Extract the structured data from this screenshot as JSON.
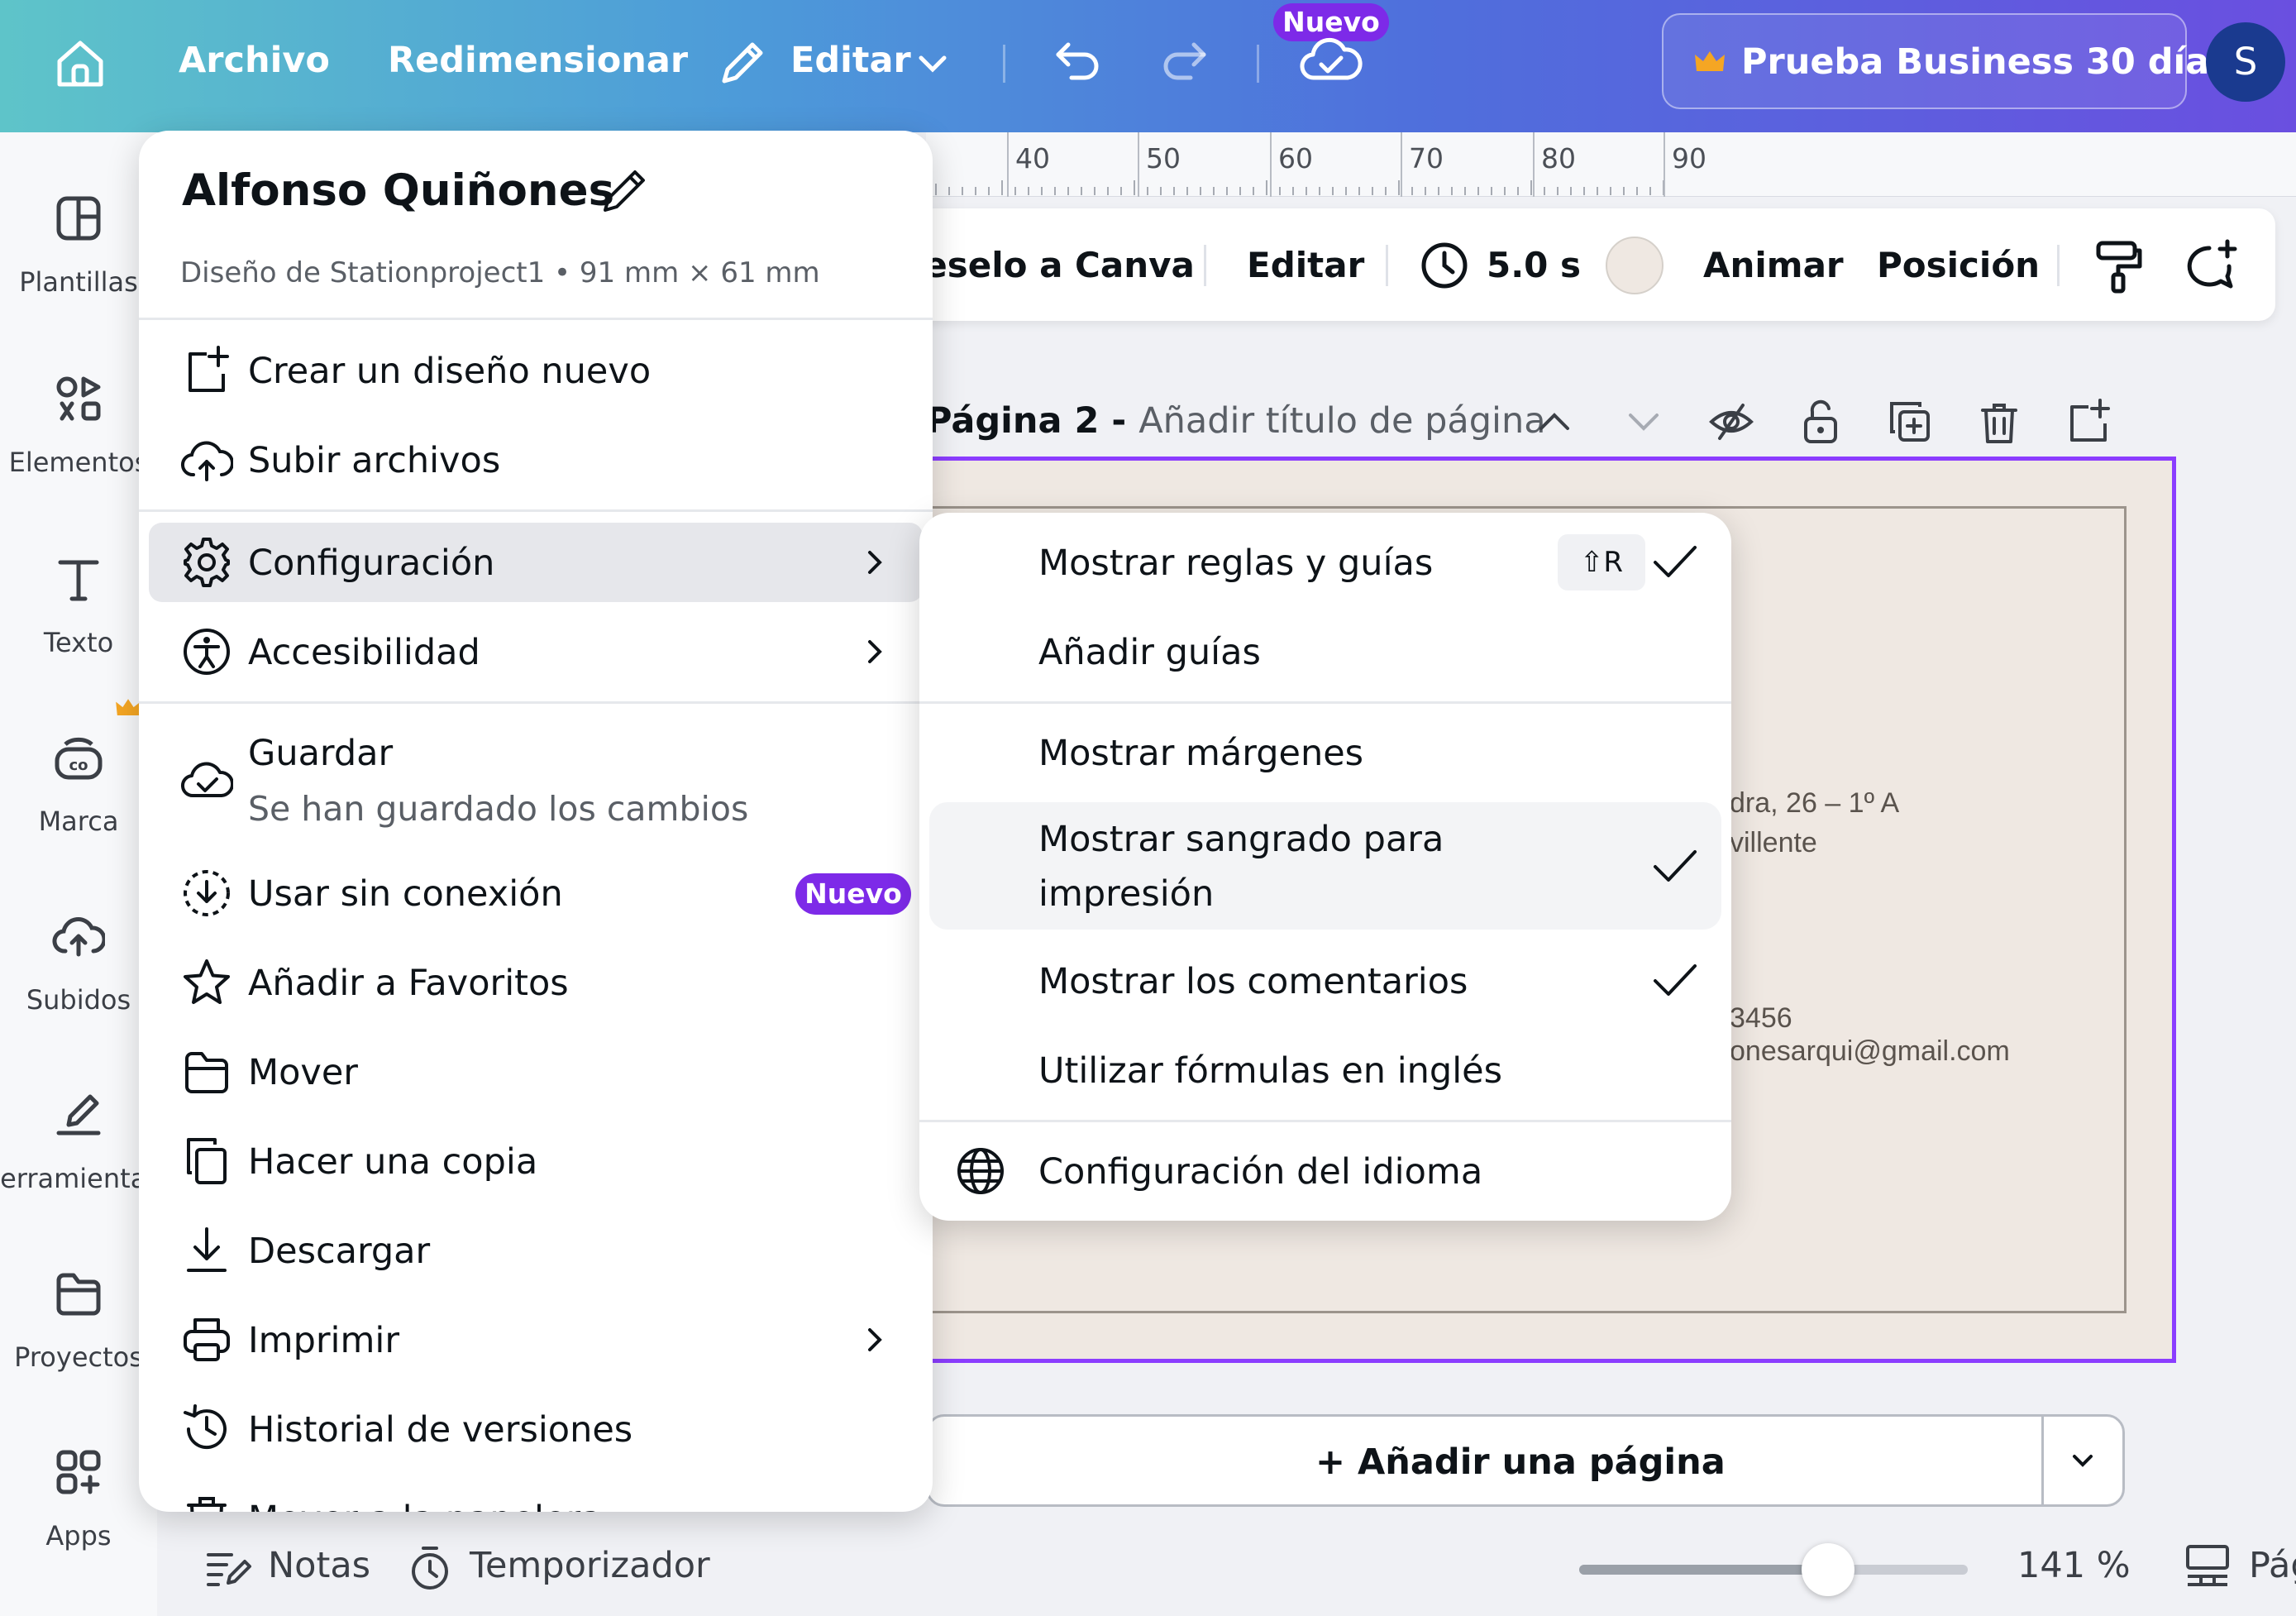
{
  "topbar": {
    "file_label": "Archivo",
    "resize_label": "Redimensionar",
    "edit_label": "Editar",
    "new_badge": "Nuevo",
    "trial_label": "Prueba Business 30 días",
    "avatar_initial": "S"
  },
  "sidebar": {
    "items": [
      {
        "label": "Plantillas",
        "icon": "templates-icon"
      },
      {
        "label": "Elementos",
        "icon": "elements-icon"
      },
      {
        "label": "Texto",
        "icon": "text-icon"
      },
      {
        "label": "Marca",
        "icon": "brand-icon"
      },
      {
        "label": "Subidos",
        "icon": "uploads-icon"
      },
      {
        "label": "Herramientas",
        "icon": "tools-icon"
      },
      {
        "label": "Proyectos",
        "icon": "projects-icon"
      },
      {
        "label": "Apps",
        "icon": "apps-icon"
      }
    ]
  },
  "ruler": {
    "ticks": [
      "40",
      "50",
      "60",
      "70",
      "80",
      "90"
    ]
  },
  "context_toolbar": {
    "canva_label": "Pídeselo a Canva",
    "edit_label": "Editar",
    "duration": "5.0 s",
    "animate_label": "Animar",
    "position_label": "Posición",
    "color_swatch": "#efe8e2"
  },
  "page": {
    "title": "Página 2 - ",
    "subtitle": "Añadir título de página",
    "add_page_label": "+ Añadir una página"
  },
  "card": {
    "address_line1": "dra, 26 – 1º A",
    "address_line2": "villente",
    "phone": "3456",
    "email": "onesarqui@gmail.com"
  },
  "bottombar": {
    "notes_label": "Notas",
    "timer_label": "Temporizador",
    "zoom_label": "141 %",
    "zoom_level": 0.64,
    "pages_label": "Pág"
  },
  "main_menu": {
    "title": "Alfonso Quiñones",
    "subtitle": "Diseño de Stationproject1 • 91 mm × 61 mm",
    "items": {
      "create": "Crear un diseño nuevo",
      "upload": "Subir archivos",
      "settings": "Configuración",
      "accessibility": "Accesibilidad",
      "save": "Guardar",
      "save_status": "Se han guardado los cambios",
      "offline": "Usar sin conexión",
      "offline_badge": "Nuevo",
      "favorites": "Añadir a Favoritos",
      "move": "Mover",
      "copy": "Hacer una copia",
      "download": "Descargar",
      "print": "Imprimir",
      "history": "Historial de versiones",
      "trash": "Mover a la papelera"
    }
  },
  "sub_menu": {
    "show_rulers": "Mostrar reglas y guías",
    "show_rulers_shortcut": "⇧R",
    "add_guides": "Añadir guías",
    "show_margins": "Mostrar márgenes",
    "show_bleed_1": "Mostrar sangrado para",
    "show_bleed_2": "impresión",
    "show_comments": "Mostrar los comentarios",
    "english_formulas": "Utilizar fórmulas en inglés",
    "language_settings": "Configuración del idioma"
  },
  "colors": {
    "accent": "#8b3dff",
    "badge": "#7d2ae8",
    "crown": "#f5a623"
  }
}
